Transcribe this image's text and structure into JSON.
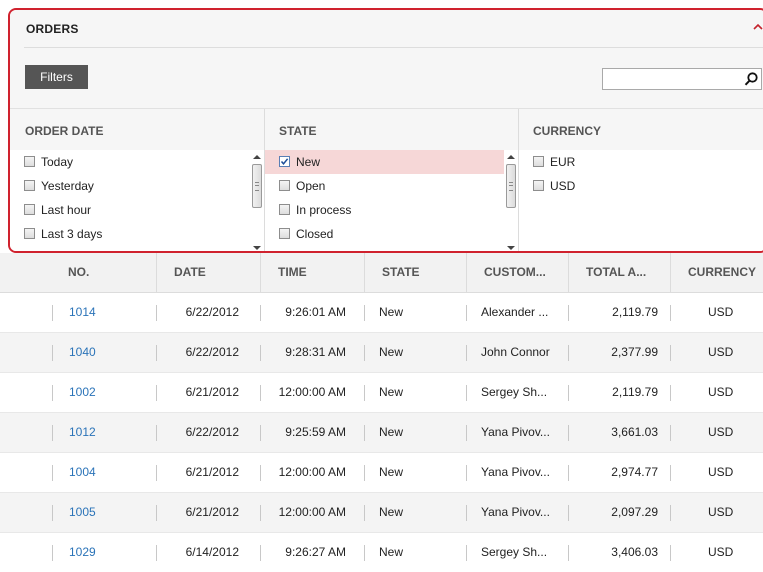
{
  "panel": {
    "title": "ORDERS",
    "collapse_glyph": "^",
    "filters_button": "Filters",
    "search": {
      "value": "",
      "placeholder": ""
    },
    "accent_color": "#d0222e"
  },
  "filters": {
    "order_date": {
      "title": "ORDER DATE",
      "items": [
        {
          "label": "Today",
          "checked": false
        },
        {
          "label": "Yesterday",
          "checked": false
        },
        {
          "label": "Last hour",
          "checked": false
        },
        {
          "label": "Last 3 days",
          "checked": false
        }
      ]
    },
    "state": {
      "title": "STATE",
      "items": [
        {
          "label": "New",
          "checked": true
        },
        {
          "label": "Open",
          "checked": false
        },
        {
          "label": "In process",
          "checked": false
        },
        {
          "label": "Closed",
          "checked": false
        }
      ]
    },
    "currency": {
      "title": "CURRENCY",
      "items": [
        {
          "label": "EUR",
          "checked": false
        },
        {
          "label": "USD",
          "checked": false
        }
      ]
    }
  },
  "grid": {
    "columns": [
      "NO.",
      "DATE",
      "TIME",
      "STATE",
      "CUSTOM...",
      "TOTAL A...",
      "CURRENCY"
    ],
    "rows": [
      [
        "1014",
        "6/22/2012",
        "9:26:01 AM",
        "New",
        "Alexander ...",
        "2,119.79",
        "USD"
      ],
      [
        "1040",
        "6/22/2012",
        "9:28:31 AM",
        "New",
        "John Connor",
        "2,377.99",
        "USD"
      ],
      [
        "1002",
        "6/21/2012",
        "12:00:00 AM",
        "New",
        "Sergey Sh...",
        "2,119.79",
        "USD"
      ],
      [
        "1012",
        "6/22/2012",
        "9:25:59 AM",
        "New",
        "Yana Pivov...",
        "3,661.03",
        "USD"
      ],
      [
        "1004",
        "6/21/2012",
        "12:00:00 AM",
        "New",
        "Yana Pivov...",
        "2,974.77",
        "USD"
      ],
      [
        "1005",
        "6/21/2012",
        "12:00:00 AM",
        "New",
        "Yana Pivov...",
        "2,097.29",
        "USD"
      ],
      [
        "1029",
        "6/14/2012",
        "9:26:27 AM",
        "New",
        "Sergey Sh...",
        "3,406.03",
        "USD"
      ]
    ]
  },
  "icons": {
    "search": "search-icon",
    "collapse": "chevron-up-icon",
    "checkbox_checked": "checkmark-icon"
  }
}
